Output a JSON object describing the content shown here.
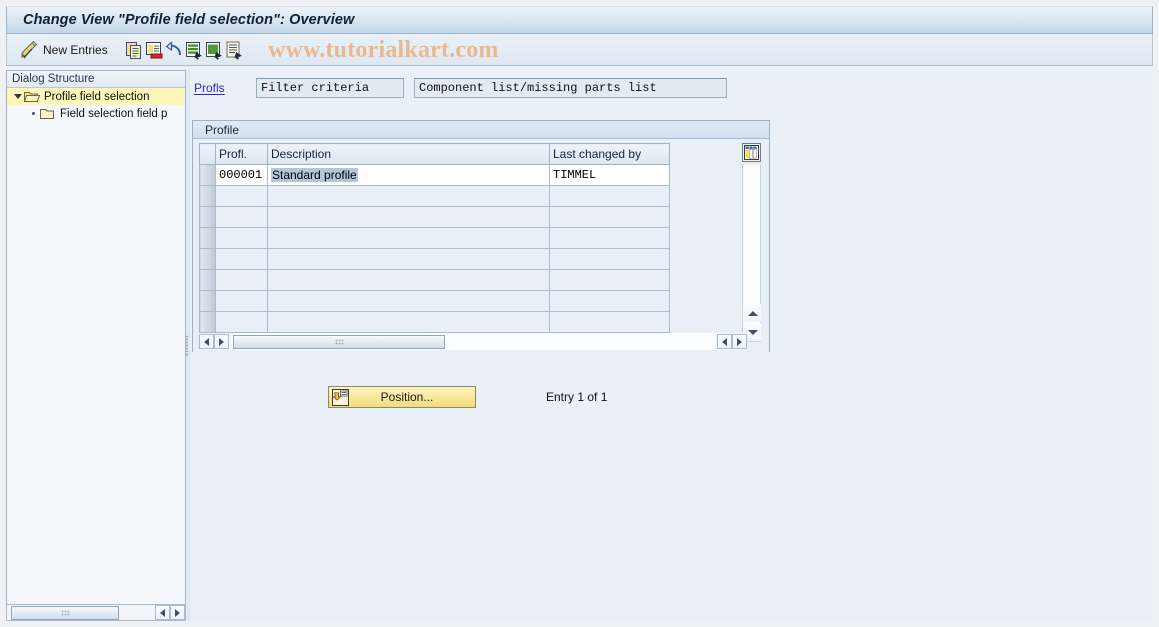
{
  "window": {
    "title": "Change View \"Profile field selection\": Overview"
  },
  "watermark": "www.tutorialkart.com",
  "toolbar": {
    "edit_icon": "pencil-icon",
    "new_entries_label": "New Entries",
    "icons": [
      "copy-icon",
      "delete-icon",
      "undo-icon",
      "select-all-icon",
      "deselect-all-icon",
      "details-icon"
    ]
  },
  "sidebar": {
    "header": "Dialog Structure",
    "items": [
      {
        "label": "Profile field selection",
        "icon": "open-folder-icon",
        "selected": true,
        "expanded": true
      },
      {
        "label": "Field selection field p",
        "icon": "closed-folder-icon",
        "selected": false,
        "expanded": false
      }
    ],
    "scroll": {
      "left_arrow": "scroll-left-icon",
      "right_arrow": "scroll-right-icon"
    }
  },
  "main": {
    "strip": {
      "label": "Profls",
      "filter_criteria": "Filter criteria",
      "component_list": "Component list/missing parts list"
    },
    "table": {
      "title": "Profile",
      "columns": [
        "Profl.",
        "Description",
        "Last changed by"
      ],
      "rows": [
        {
          "profl": "000001",
          "description": "Standard profile",
          "last_changed_by": "TIMMEL",
          "selected": true
        }
      ],
      "empty_row_count": 7,
      "config_icon": "column-config-icon",
      "vscroll": {
        "up": "scroll-up-icon",
        "down": "scroll-down-icon"
      },
      "hscroll": {
        "left": "scroll-left-icon",
        "right": "scroll-right-icon"
      }
    },
    "position_button": {
      "label": "Position...",
      "icon": "position-icon"
    },
    "entry_status": "Entry 1 of 1"
  },
  "colors": {
    "title_bar": "#c3d5e8",
    "selection_highlight": "#fdf6b8",
    "cell_selection": "#b3c6dc",
    "watermark": "#e8b88e",
    "button_yellow": "#f7e79a",
    "link_blue": "#2b2bc8"
  }
}
